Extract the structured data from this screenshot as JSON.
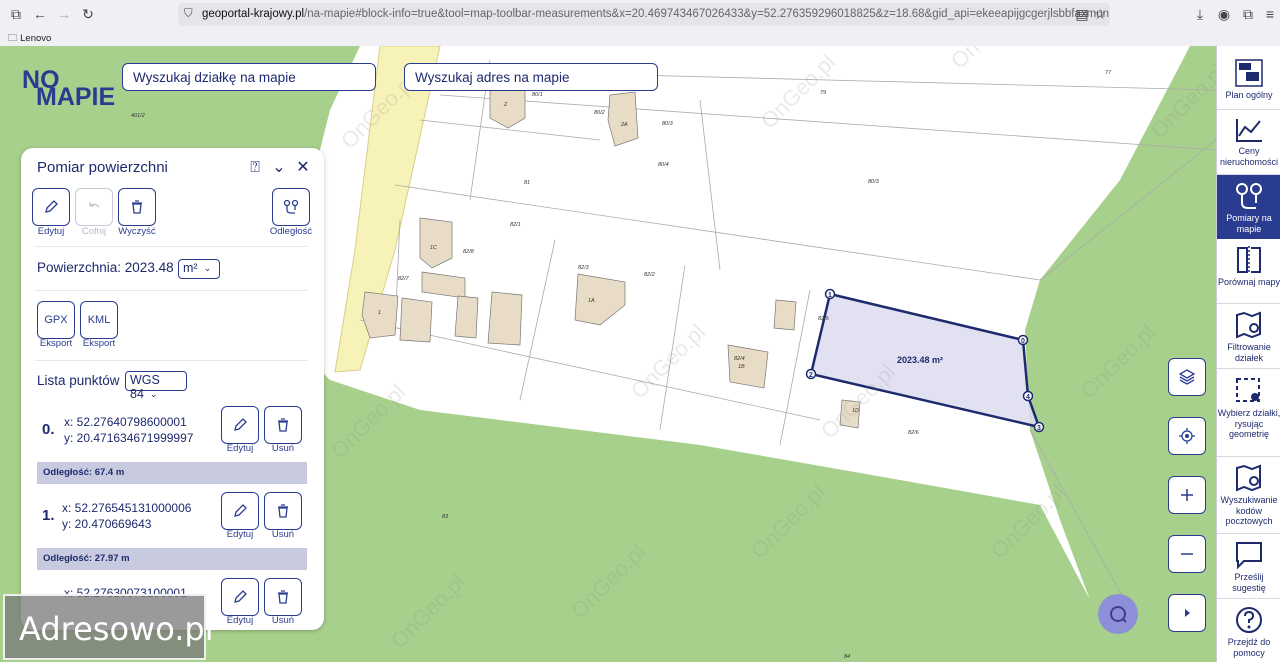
{
  "browser": {
    "url_domain": "geoportal-krajowy.pl",
    "url_rest": "/na-mapie#block-info=true&tool=map-toolbar-measurements&x=20.469743467026433&y=52.276359296018825&z=18.68&gid_api=ekeeapijgcgerjlsbbfaxmun",
    "bookmark": "Lenovo"
  },
  "logo": {
    "text_n": "N",
    "text_mapie": "MAPIE"
  },
  "search": {
    "parcel": "Wyszukaj działkę na mapie",
    "address": "Wyszukaj adres na mapie"
  },
  "panel": {
    "title": "Pomiar powierzchni",
    "tools": {
      "edit": "Edytuj",
      "undo": "Cofnij",
      "clear": "Wyczyść",
      "distance": "Odległość"
    },
    "area_label": "Powierzchnia: 2023.48",
    "area_unit": "m²",
    "export_gpx": "GPX",
    "export_kml": "KML",
    "export_label": "Eksport",
    "points_title": "Lista punktów",
    "crs": "WGS 84",
    "points": [
      {
        "num": "0.",
        "x": "x: 52.27640798600001",
        "y": "y: 20.471634671999997",
        "edit": "Edytuj",
        "remove": "Usuń",
        "distance": "Odległość: 67.4 m"
      },
      {
        "num": "1.",
        "x": "x: 52.276545131000006",
        "y": "y: 20.470669643",
        "edit": "Edytuj",
        "remove": "Usuń",
        "distance": "Odległość: 27.97 m"
      },
      {
        "num": "",
        "x": "x: 52.27630073100001",
        "y": "",
        "edit": "Edytuj",
        "remove": "Usuń"
      }
    ]
  },
  "map": {
    "area_label": "2023.48 m²",
    "vertex_labels": [
      "1",
      "2",
      "3",
      "4",
      "0"
    ],
    "parcels": [
      "80/1",
      "80/2",
      "2A",
      "80/3",
      "80/4",
      "79",
      "77",
      "81",
      "82/1",
      "82/2",
      "82/3",
      "82/4",
      "82/5",
      "82/6",
      "82/7",
      "82/8",
      "80/3",
      "83",
      "84",
      "1C",
      "1A",
      "1B",
      "1D",
      "2",
      "1",
      "401/2"
    ],
    "watermark": "OnGeo.pl",
    "overlay_text": "Adresowo.pl"
  },
  "sidebar": [
    {
      "label": "Plan ogólny"
    },
    {
      "label": "Ceny nieruchomości"
    },
    {
      "label": "Pomiary na mapie"
    },
    {
      "label": "Porównaj mapy"
    },
    {
      "label": "Filtrowanie działek"
    },
    {
      "label": "Wybierz działki, rysując geometrię"
    },
    {
      "label": "Wyszukiwanie kodów pocztowych"
    },
    {
      "label": "Prześlij sugestię"
    },
    {
      "label": "Przejdź do pomocy"
    }
  ],
  "colors": {
    "accent": "#2a3c8f",
    "grass": "#a8d08d",
    "land": "#ffffff",
    "polygon_fill": "#dcdcf0"
  }
}
